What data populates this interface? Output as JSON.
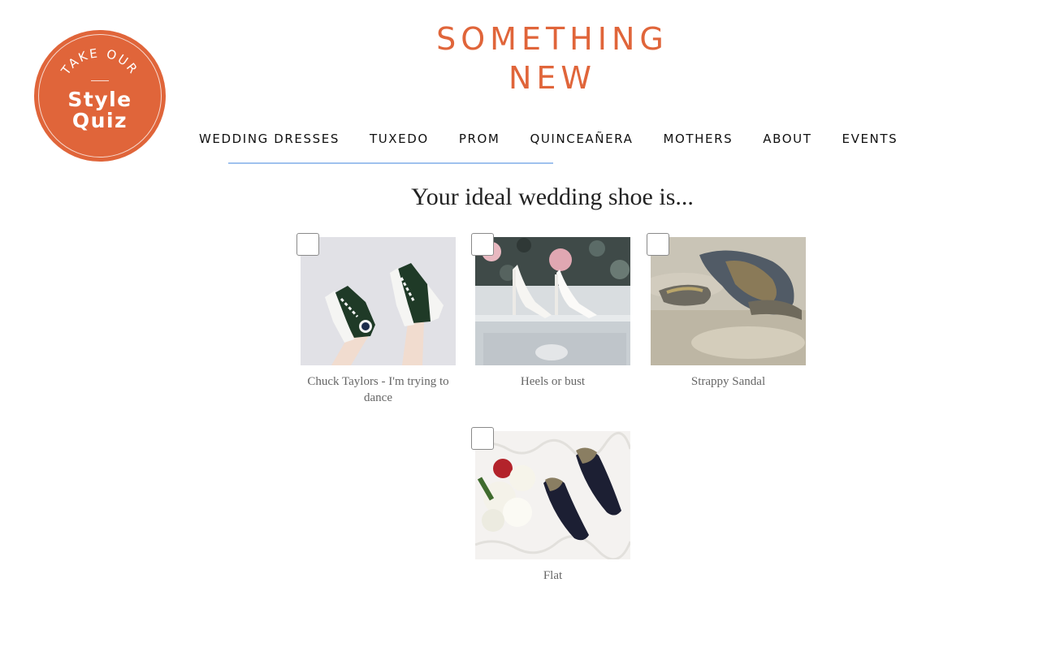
{
  "badge": {
    "line1": "TAKE OUR",
    "line2": "Style",
    "line3": "Quiz"
  },
  "logo": {
    "line1": "SOMETHING",
    "line2": "NEW"
  },
  "nav": {
    "items": [
      "WEDDING DRESSES",
      "TUXEDO",
      "PROM",
      "QUINCEAÑERA",
      "MOTHERS",
      "ABOUT",
      "EVENTS"
    ]
  },
  "question": "Your ideal wedding shoe is...",
  "options": [
    {
      "label": "Chuck Taylors - I'm trying to dance",
      "image": "converse-sneakers-image"
    },
    {
      "label": "Heels or bust",
      "image": "white-heels-image"
    },
    {
      "label": "Strappy Sandal",
      "image": "sandals-on-sand-image"
    },
    {
      "label": "Flat",
      "image": "black-flats-with-roses-image"
    }
  ],
  "colors": {
    "brand": "#e0653a",
    "underline": "#9fc1ee"
  }
}
